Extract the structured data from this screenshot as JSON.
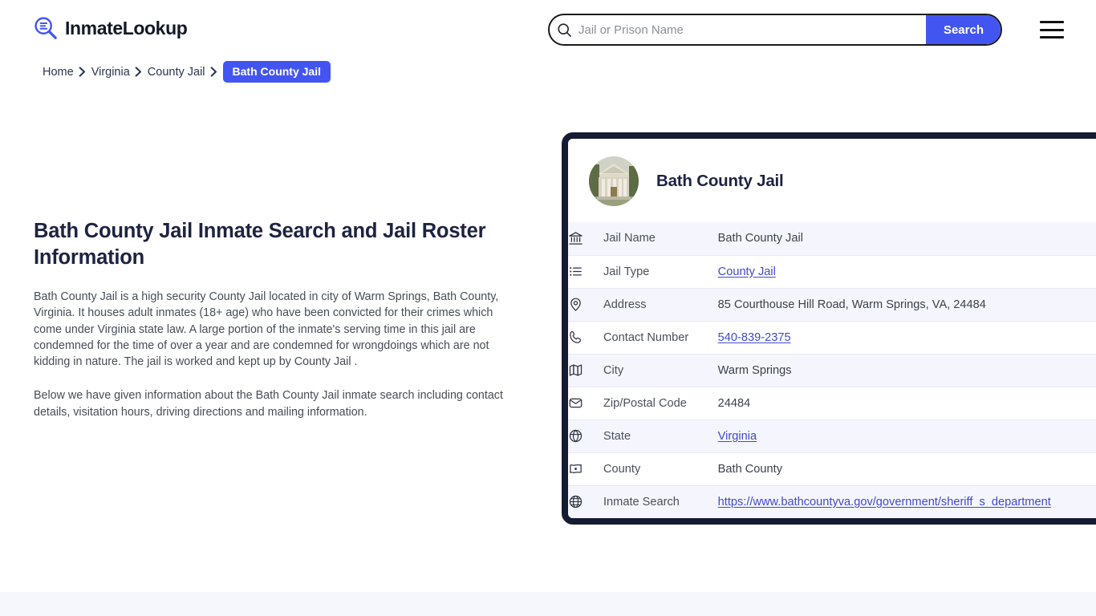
{
  "header": {
    "logo_text": "InmateLookup",
    "logo_icon": "magnifier-list-icon",
    "search": {
      "placeholder": "Jail or Prison Name",
      "value": "",
      "button_label": "Search",
      "icon": "search-icon"
    },
    "menu_icon": "hamburger-menu-icon"
  },
  "breadcrumb": {
    "items": [
      {
        "label": "Home",
        "current": false
      },
      {
        "label": "Virginia",
        "current": false
      },
      {
        "label": "County Jail",
        "current": false
      },
      {
        "label": "Bath County Jail",
        "current": true
      }
    ],
    "separator": "›"
  },
  "main": {
    "title": "Bath County Jail Inmate Search and Jail Roster Information",
    "paragraphs": [
      "Bath County Jail is a high security County Jail located in city of Warm Springs, Bath County, Virginia. It houses adult inmates (18+ age) who have been convicted for their crimes which come under Virginia state law. A large portion of the inmate's serving time in this jail are condemned for the time of over a year and are condemned for wrongdoings which are not kidding in nature. The jail is worked and kept up by County Jail .",
      "Below we have given information about the Bath County Jail inmate search including contact details, visitation hours, driving directions and mailing information."
    ]
  },
  "card": {
    "avatar_icon": "courthouse-photo",
    "title": "Bath County Jail",
    "rows": [
      {
        "icon": "bank-icon",
        "label": "Jail Name",
        "value": "Bath County Jail",
        "link": false
      },
      {
        "icon": "list-icon",
        "label": "Jail Type",
        "value": "County Jail",
        "link": true
      },
      {
        "icon": "map-pin-icon",
        "label": "Address",
        "value": "85 Courthouse Hill Road, Warm Springs, VA, 24484",
        "link": false
      },
      {
        "icon": "phone-icon",
        "label": "Contact Number",
        "value": "540-839-2375",
        "link": true,
        "tight": true
      },
      {
        "icon": "map-icon",
        "label": "City",
        "value": "Warm Springs",
        "link": false
      },
      {
        "icon": "envelope-icon",
        "label": "Zip/Postal Code",
        "value": "24484",
        "link": false,
        "tight": true
      },
      {
        "icon": "globe-grid-icon",
        "label": "State",
        "value": "Virginia",
        "link": true
      },
      {
        "icon": "county-icon",
        "label": "County",
        "value": "Bath County",
        "link": false
      },
      {
        "icon": "web-icon",
        "label": "Inmate Search",
        "value": "https://www.bathcountyva.gov/government/sheriff_s_department",
        "link": true
      }
    ]
  },
  "colors": {
    "accent_blue": "#4355f0",
    "card_border_navy": "#151b33",
    "heading_navy": "#1d2340",
    "row_stripe": "#f5f6fd",
    "link": "#4149c8",
    "footer_band": "#f6f6fd"
  }
}
